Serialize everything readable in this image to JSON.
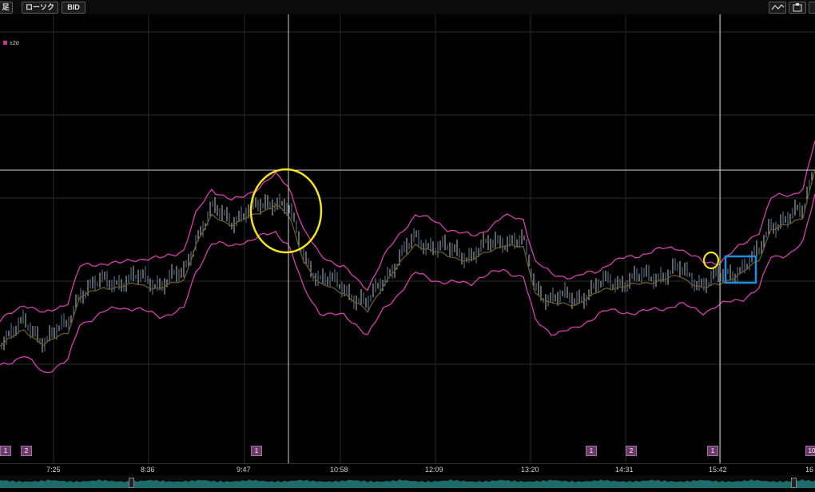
{
  "toolbar": {
    "period_label": "足",
    "candle_label": "ローソク",
    "price_label": "BID"
  },
  "legend": {
    "label": "±2σ",
    "color": "#cc3399"
  },
  "markers": [
    "1",
    "2",
    "1",
    "1",
    "2",
    "1",
    "10"
  ],
  "xaxis_ticks": [
    "7:25",
    "8:36",
    "9:47",
    "10:58",
    "12:09",
    "13:20",
    "14:31",
    "15:42",
    "16"
  ],
  "colors": {
    "background": "#000000",
    "band": "#d73fae",
    "ma": "#6b5a2a",
    "candle": "#5a7fa0",
    "highlight_circle": "#f2e51a",
    "highlight_box": "#1e8fe0",
    "crosshair": "#cfcfcf",
    "navigator": "#1d6b6b"
  }
}
